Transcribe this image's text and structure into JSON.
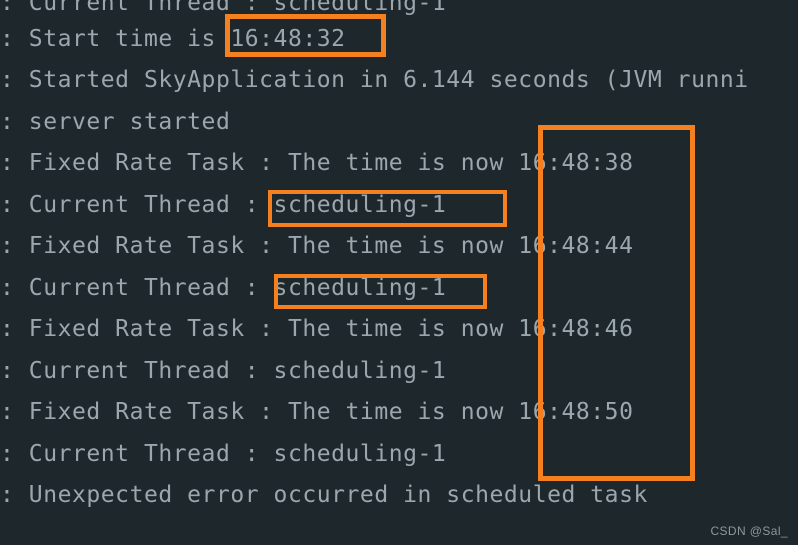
{
  "terminal": {
    "background_color": "#1e272c",
    "text_color": "#9aa7ad",
    "accent_color": "#f4801f",
    "lines": [
      {
        "text": ": Current Thread : scheduling-1"
      },
      {
        "text": ": Start time is 16:48:32"
      },
      {
        "text": ": Started SkyApplication in 6.144 seconds (JVM runni"
      },
      {
        "text": ": server started"
      },
      {
        "text": ": Fixed Rate Task : The time is now 16:48:38"
      },
      {
        "text": ": Current Thread : scheduling-1"
      },
      {
        "text": ": Fixed Rate Task : The time is now 16:48:44"
      },
      {
        "text": ": Current Thread : scheduling-1"
      },
      {
        "text": ": Fixed Rate Task : The time is now 16:48:46"
      },
      {
        "text": ": Current Thread : scheduling-1"
      },
      {
        "text": ": Fixed Rate Task : The time is now 16:48:50"
      },
      {
        "text": ": Current Thread : scheduling-1"
      },
      {
        "text": ": Unexpected error occurred in scheduled task"
      }
    ],
    "highlights": [
      {
        "label": "start-time-highlight",
        "value": "16:48:32"
      },
      {
        "label": "thread-name-highlight-1",
        "value": "scheduling-1"
      },
      {
        "label": "thread-name-highlight-2",
        "value": "scheduling-1"
      },
      {
        "label": "timestamps-column-highlight",
        "value": "16:48:38 / 16:48:44 / 16:48:46 / 16:48:50"
      }
    ]
  },
  "watermark": {
    "text": "CSDN @Sal_"
  }
}
